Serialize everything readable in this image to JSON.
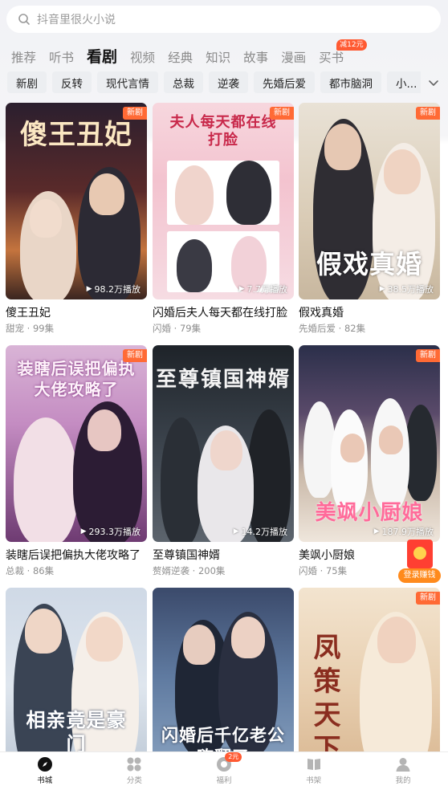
{
  "search": {
    "placeholder": "抖音里很火小说"
  },
  "tabs": [
    {
      "label": "推荐"
    },
    {
      "label": "听书"
    },
    {
      "label": "看剧",
      "active": true
    },
    {
      "label": "视频"
    },
    {
      "label": "经典"
    },
    {
      "label": "知识"
    },
    {
      "label": "故事"
    },
    {
      "label": "漫画"
    },
    {
      "label": "买书",
      "badge": "减12元"
    }
  ],
  "chips": [
    "新剧",
    "反转",
    "现代言情",
    "总裁",
    "逆袭",
    "先婚后爱",
    "都市脑洞",
    "小..."
  ],
  "dramas": [
    {
      "name": "傻王丑妃",
      "genre": "甜宠",
      "episodes": "99集",
      "views": "98.2万播放",
      "badge": "新剧",
      "poster_title": "傻王丑妃"
    },
    {
      "name": "闪婚后夫人每天都在线打脸",
      "genre": "闪婚",
      "episodes": "79集",
      "views": "7.7万播放",
      "badge": "新剧",
      "poster_title": "夫人每天都在线打脸"
    },
    {
      "name": "假戏真婚",
      "genre": "先婚后爱",
      "episodes": "82集",
      "views": "38.5万播放",
      "badge": "新剧",
      "poster_title": "假戏真婚"
    },
    {
      "name": "装瞎后误把偏执大佬攻略了",
      "genre": "总裁",
      "episodes": "86集",
      "views": "293.3万播放",
      "badge": "新剧",
      "poster_title": "装瞎后误把偏执大佬攻略了"
    },
    {
      "name": "至尊镇国神婿",
      "genre": "赘婿逆袭",
      "episodes": "200集",
      "views": "14.2万播放",
      "badge": "",
      "poster_title": "至尊镇国神婿"
    },
    {
      "name": "美飒小厨娘",
      "genre": "闪婚",
      "episodes": "75集",
      "views": "187.9万播放",
      "badge": "新剧",
      "poster_title": "美飒小厨娘"
    },
    {
      "name": "",
      "genre": "",
      "episodes": "",
      "views": "",
      "badge": "",
      "poster_title": "相亲竟是豪门"
    },
    {
      "name": "",
      "genre": "",
      "episodes": "",
      "views": "",
      "badge": "",
      "poster_title": "闪婚后千亿老公嗨翻了"
    },
    {
      "name": "",
      "genre": "",
      "episodes": "",
      "views": "",
      "badge": "新剧",
      "poster_title": "凤策天下"
    }
  ],
  "earn": {
    "label": "登录赚钱"
  },
  "bottom_nav": [
    {
      "label": "书城",
      "icon": "compass-icon",
      "active": true
    },
    {
      "label": "分类",
      "icon": "category-icon"
    },
    {
      "label": "福利",
      "icon": "gift-icon",
      "badge": "2元"
    },
    {
      "label": "书架",
      "icon": "book-icon"
    },
    {
      "label": "我的",
      "icon": "user-icon"
    }
  ],
  "colors": {
    "accent": "#ff6a35",
    "badge": "#ff5a32",
    "earn": "#ff8a1c"
  }
}
